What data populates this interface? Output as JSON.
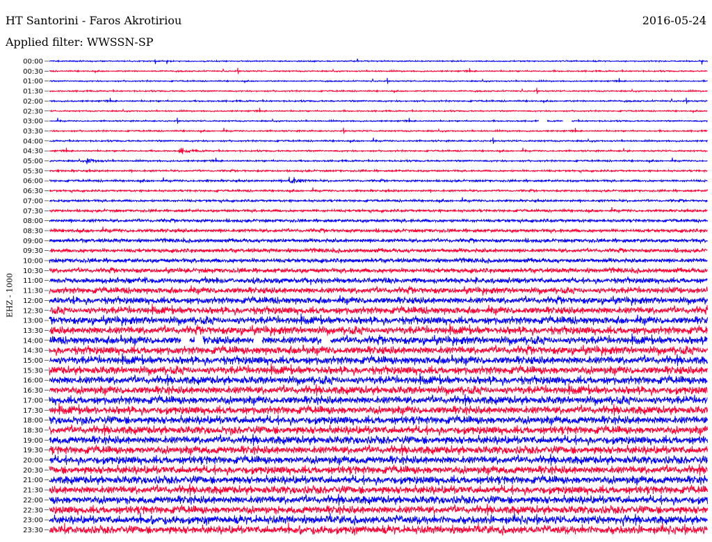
{
  "header": {
    "station": "HT Santorini - Faros Akrotiriou",
    "date": "2016-05-24",
    "filter": "Applied filter: WWSSN-SP"
  },
  "chart_data": {
    "type": "line",
    "title": "HT Santorini - Faros Akrotiriou",
    "subtitle": "Applied filter: WWSSN-SP",
    "date": "2016-05-24",
    "ylabel": "EHZ - 1000",
    "rows": [
      "00:00",
      "00:30",
      "01:00",
      "01:30",
      "02:00",
      "02:30",
      "03:00",
      "03:30",
      "04:00",
      "04:30",
      "05:00",
      "05:30",
      "06:00",
      "06:30",
      "07:00",
      "07:30",
      "08:00",
      "08:30",
      "09:00",
      "09:30",
      "10:00",
      "10:30",
      "11:00",
      "11:30",
      "12:00",
      "12:30",
      "13:00",
      "13:30",
      "14:00",
      "14:30",
      "15:00",
      "15:30",
      "16:00",
      "16:30",
      "17:00",
      "17:30",
      "18:00",
      "18:30",
      "19:00",
      "19:30",
      "20:00",
      "20:30",
      "21:00",
      "21:30",
      "22:00",
      "22:30",
      "23:00",
      "23:30"
    ],
    "row_colors": [
      "#0000ff",
      "#ff0033"
    ],
    "noise_level": [
      1.2,
      1.3,
      1.2,
      1.3,
      1.5,
      1.3,
      1.3,
      1.4,
      1.5,
      1.5,
      1.6,
      1.8,
      2.0,
      1.9,
      2.2,
      2.5,
      3.0,
      3.3,
      3.6,
      3.8,
      4.2,
      4.6,
      5.2,
      6.0,
      6.5,
      7.0,
      7.4,
      7.6,
      7.6,
      7.7,
      7.8,
      7.8,
      7.8,
      7.8,
      7.8,
      7.8,
      7.8,
      7.8,
      7.8,
      7.8,
      7.8,
      7.8,
      7.8,
      7.8,
      7.8,
      7.8,
      7.8,
      7.8
    ],
    "events": [
      {
        "row": "06:00",
        "minute": 11,
        "amplitude": 9
      },
      {
        "row": "04:30",
        "minute": 6,
        "amplitude": 6
      },
      {
        "row": "05:00",
        "minute": 1.8,
        "amplitude": 5
      }
    ],
    "gaps": [
      {
        "row": "03:00",
        "minute": 22.5
      },
      {
        "row": "03:00",
        "minute": 23.6
      },
      {
        "row": "14:00",
        "minute": 6.2
      },
      {
        "row": "14:00",
        "minute": 6.8
      },
      {
        "row": "14:00",
        "minute": 9.5
      },
      {
        "row": "14:00",
        "minute": 12.6
      }
    ],
    "grid": false,
    "legend": "none"
  }
}
